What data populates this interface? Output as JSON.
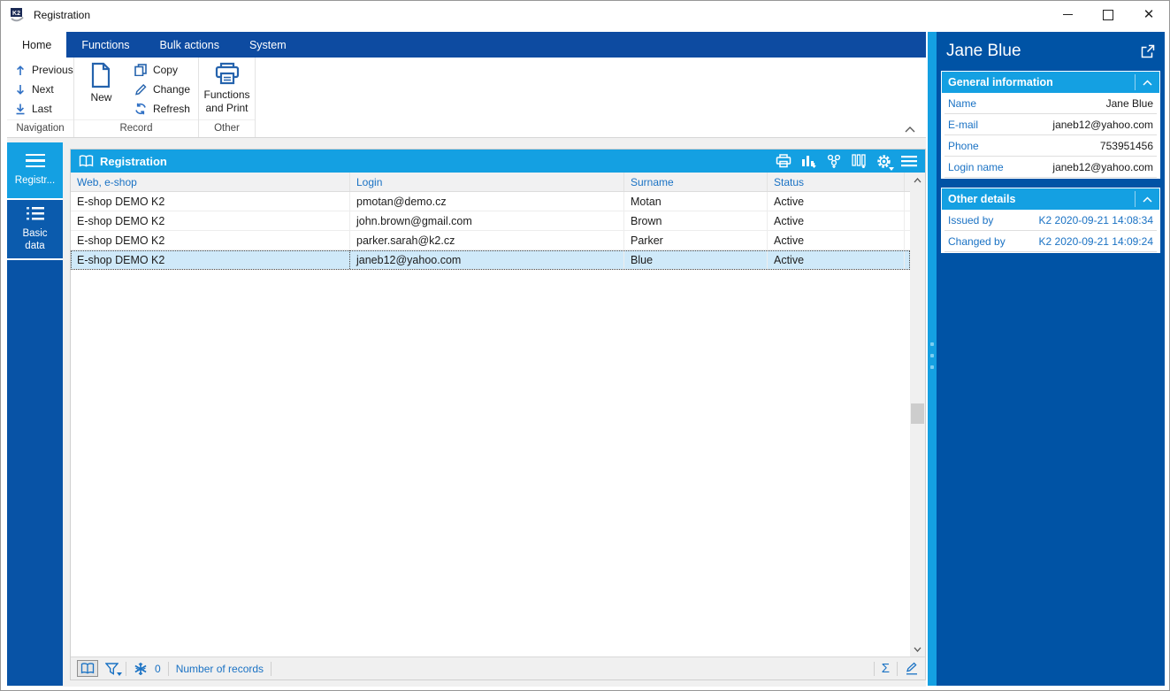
{
  "window": {
    "title": "Registration",
    "controls": [
      "minimize",
      "maximize",
      "close"
    ]
  },
  "ribbon": {
    "tabs": [
      {
        "label": "Home",
        "active": true
      },
      {
        "label": "Functions",
        "active": false
      },
      {
        "label": "Bulk actions",
        "active": false
      },
      {
        "label": "System",
        "active": false
      }
    ],
    "groups": [
      {
        "label": "Navigation",
        "buttons": [
          {
            "label": "Previous",
            "icon": "arrow-up-icon"
          },
          {
            "label": "Next",
            "icon": "arrow-down-icon"
          },
          {
            "label": "Last",
            "icon": "arrow-down-last-icon"
          }
        ]
      },
      {
        "label": "Record",
        "big_button": {
          "label": "New",
          "icon": "new-document-icon"
        },
        "buttons": [
          {
            "label": "Copy",
            "icon": "copy-icon"
          },
          {
            "label": "Change",
            "icon": "pencil-icon"
          },
          {
            "label": "Refresh",
            "icon": "refresh-icon"
          }
        ]
      },
      {
        "label": "Other",
        "big_button": {
          "label": "Functions and Print",
          "icon": "printer-icon"
        }
      }
    ],
    "collapse_icon": "chevron-up-icon"
  },
  "sidebar": {
    "items": [
      {
        "label": "Registr...",
        "icon": "menu-icon",
        "active": true
      },
      {
        "label": "Basic data",
        "icon": "list-icon",
        "active": false
      }
    ]
  },
  "browse": {
    "title": "Registration",
    "title_icon": "book-icon",
    "toolbar_icons": [
      "printer-icon",
      "bar-chart-icon",
      "process-icon",
      "columns-icon",
      "gear-icon",
      "menu-icon"
    ],
    "columns": [
      "Web, e-shop",
      "Login",
      "Surname",
      "Status"
    ],
    "rows": [
      {
        "web": "E-shop DEMO K2",
        "login": "pmotan@demo.cz",
        "surname": "Motan",
        "status": "Active",
        "selected": false
      },
      {
        "web": "E-shop DEMO K2",
        "login": "john.brown@gmail.com",
        "surname": "Brown",
        "status": "Active",
        "selected": false
      },
      {
        "web": "E-shop DEMO K2",
        "login": "parker.sarah@k2.cz",
        "surname": "Parker",
        "status": "Active",
        "selected": false
      },
      {
        "web": "E-shop DEMO K2",
        "login": "janeb12@yahoo.com",
        "surname": "Blue",
        "status": "Active",
        "selected": true
      }
    ],
    "footer": {
      "icons": [
        "book-icon",
        "filter-icon",
        "snowflake-icon"
      ],
      "frozen_count": "0",
      "records_label": "Number of records",
      "sum_symbol": "Σ",
      "right_icons": [
        "sigma-icon",
        "edit-pencil-icon"
      ]
    }
  },
  "preview": {
    "title": "Jane Blue",
    "open_icon": "open-in-new-icon",
    "sections": [
      {
        "title": "General information",
        "collapse_icon": "chevron-up-icon",
        "fields": [
          {
            "label": "Name",
            "value": "Jane Blue"
          },
          {
            "label": "E-mail",
            "value": "janeb12@yahoo.com"
          },
          {
            "label": "Phone",
            "value": "753951456"
          },
          {
            "label": "Login name",
            "value": "janeb12@yahoo.com"
          }
        ]
      },
      {
        "title": "Other details",
        "collapse_icon": "chevron-up-icon",
        "fields": [
          {
            "label": "Issued by",
            "value": "K2 2020-09-21 14:08:34"
          },
          {
            "label": "Changed by",
            "value": "K2 2020-09-21 14:09:24"
          }
        ]
      }
    ]
  },
  "colors": {
    "accent_bright": "#14a0e2",
    "accent_dark": "#0d4ba1",
    "panel_dark": "#0053a5",
    "sidebar_dark": "#0853a6",
    "link_blue": "#1a72c4",
    "selected_row": "#cfe9f9",
    "chrome_gray": "#f0f0f0"
  }
}
